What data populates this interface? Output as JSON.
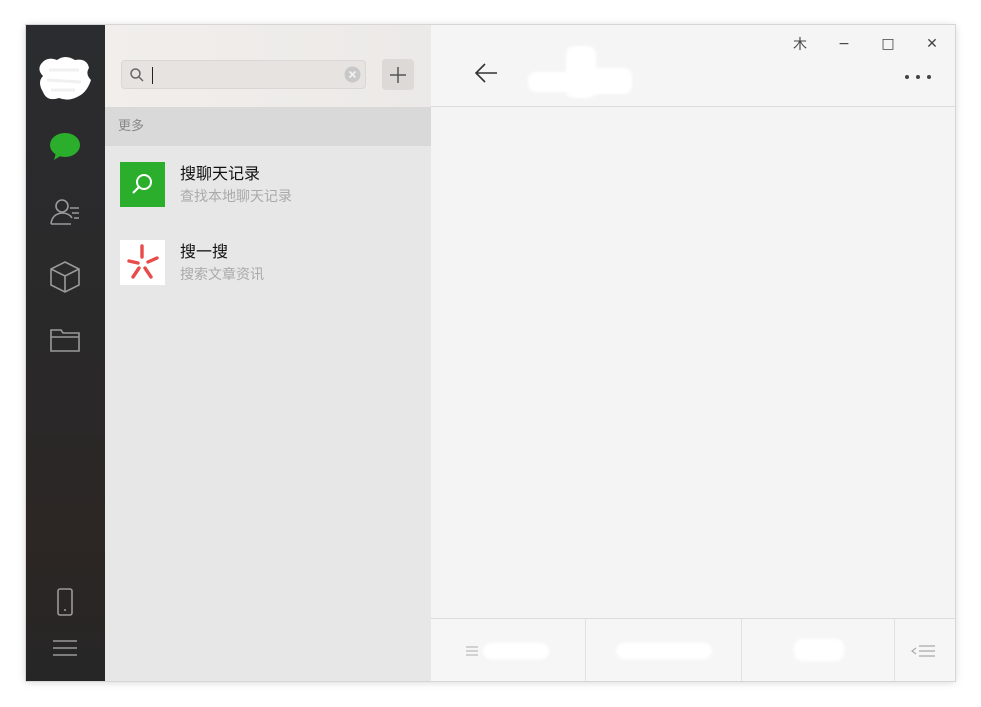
{
  "search": {
    "value": "",
    "placeholder": ""
  },
  "section": {
    "title": "更多"
  },
  "results": [
    {
      "title": "搜聊天记录",
      "subtitle": "查找本地聊天记录",
      "icon": "chat-record-search-icon"
    },
    {
      "title": "搜一搜",
      "subtitle": "搜索文章资讯",
      "icon": "sousou-logo-icon"
    }
  ],
  "window_controls": {
    "pin": "⽊",
    "minimize": "−",
    "maximize": "□",
    "close": "✕"
  },
  "colors": {
    "green": "#2aae2b",
    "sidebar": "#2b2c2f",
    "accent_red": "#e94b4b"
  }
}
